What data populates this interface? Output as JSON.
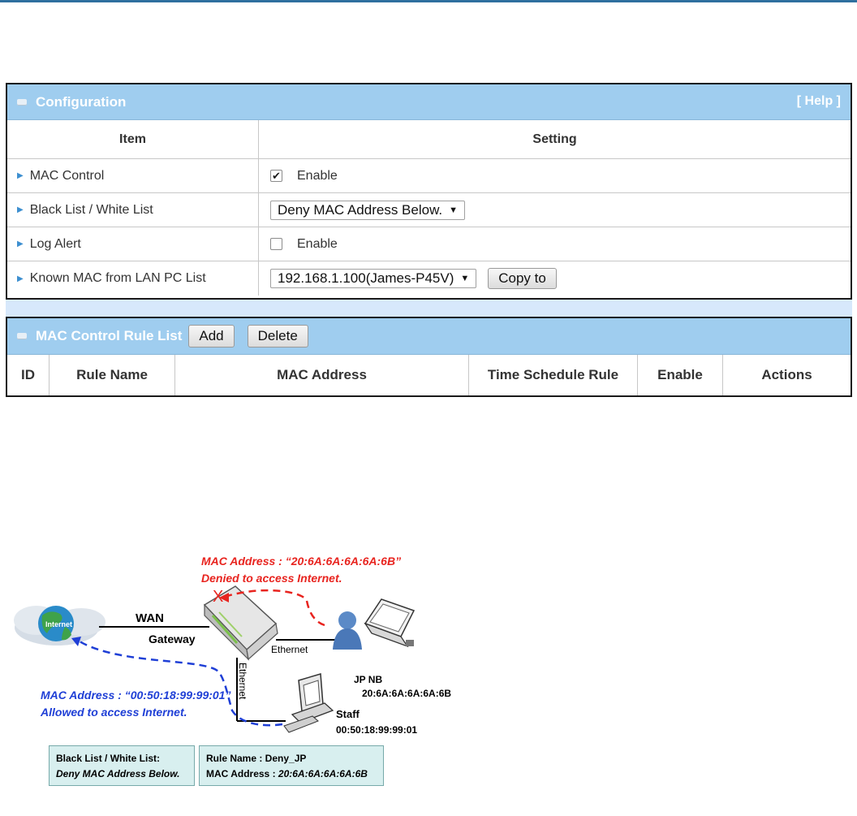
{
  "config": {
    "title": "Configuration",
    "help": "[ Help ]",
    "col_item": "Item",
    "col_setting": "Setting",
    "rows": [
      {
        "label": "MAC Control",
        "checkbox_checked": true,
        "checkbox_label": "Enable"
      },
      {
        "label": "Black List / White List",
        "select_value": "Deny MAC Address Below."
      },
      {
        "label": "Log Alert",
        "checkbox_checked": false,
        "checkbox_label": "Enable"
      },
      {
        "label": "Known MAC from LAN PC List",
        "select_value": "192.168.1.100(James-P45V)",
        "button": "Copy to"
      }
    ]
  },
  "rule_list": {
    "title": "MAC Control Rule List",
    "add": "Add",
    "delete": "Delete",
    "columns": [
      "ID",
      "Rule Name",
      "MAC Address",
      "Time Schedule Rule",
      "Enable",
      "Actions"
    ]
  },
  "diagram": {
    "internet": "Internet",
    "wan": "WAN",
    "gateway": "Gateway",
    "ethernet_h": "Ethernet",
    "ethernet_v": "Ethernet",
    "x_mark": "X",
    "red_line1": "MAC Address : “20:6A:6A:6A:6A:6B”",
    "red_line2": "Denied to access Internet.",
    "blue_line1": "MAC Address : “00:50:18:99:99:01”",
    "blue_line2": "Allowed to access Internet.",
    "jpnb_name": "JP NB",
    "jpnb_mac": "20:6A:6A:6A:6A:6B",
    "staff_name": "Staff",
    "staff_mac": "00:50:18:99:99:01",
    "box1_label": "Black List / White List:",
    "box1_value": "Deny MAC Address Below.",
    "box2_line1": "Rule Name : Deny_JP",
    "box2_label": "MAC Address : ",
    "box2_value": "20:6A:6A:6A:6A:6B",
    "colors": {
      "red": "#e8241f",
      "blue": "#1f3fd6",
      "header": "#9fcdef"
    }
  }
}
